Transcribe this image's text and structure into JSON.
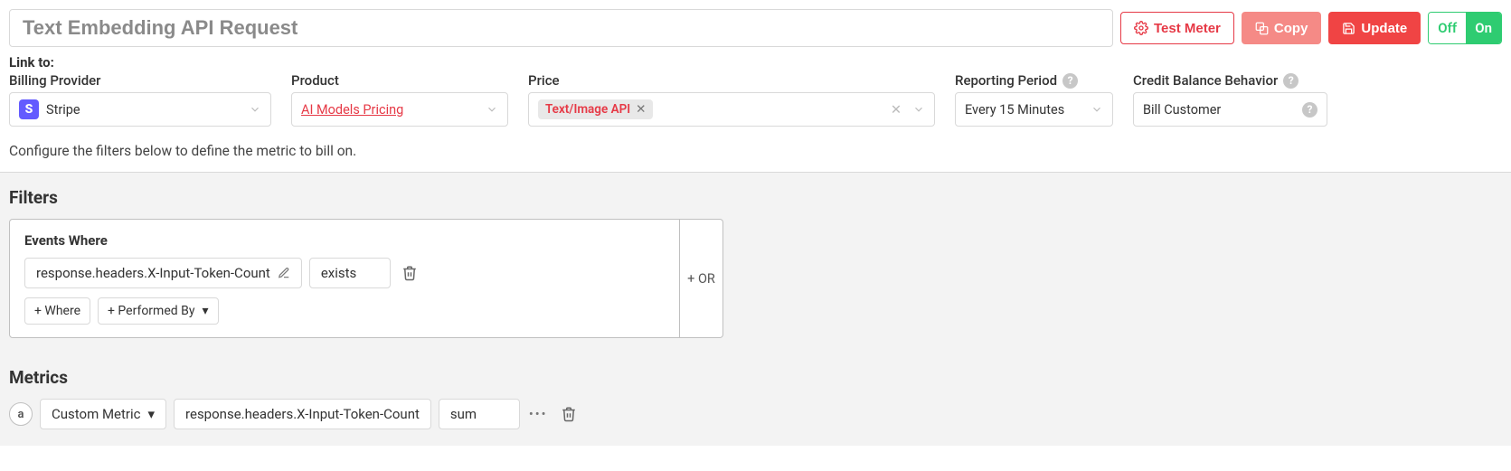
{
  "header": {
    "title_value": "Text Embedding API Request",
    "test_meter": "Test Meter",
    "copy": "Copy",
    "update": "Update",
    "toggle_off": "Off",
    "toggle_on": "On"
  },
  "link": {
    "link_to": "Link to:",
    "billing_provider_label": "Billing Provider",
    "billing_provider_value": "Stripe",
    "product_label": "Product",
    "product_value": "AI Models Pricing",
    "price_label": "Price",
    "price_chip": "Text/Image API",
    "reporting_label": "Reporting Period",
    "reporting_value": "Every 15 Minutes",
    "credit_label": "Credit Balance Behavior",
    "credit_value": "Bill Customer"
  },
  "hint": "Configure the filters below to define the metric to bill on.",
  "filters": {
    "title": "Filters",
    "events_where": "Events Where",
    "field": "response.headers.X-Input-Token-Count",
    "op": "exists",
    "add_where": "+ Where",
    "add_performed_by": "+ Performed By",
    "or": "+ OR"
  },
  "metrics": {
    "title": "Metrics",
    "badge": "a",
    "metric_type": "Custom Metric",
    "field": "response.headers.X-Input-Token-Count",
    "agg": "sum"
  }
}
